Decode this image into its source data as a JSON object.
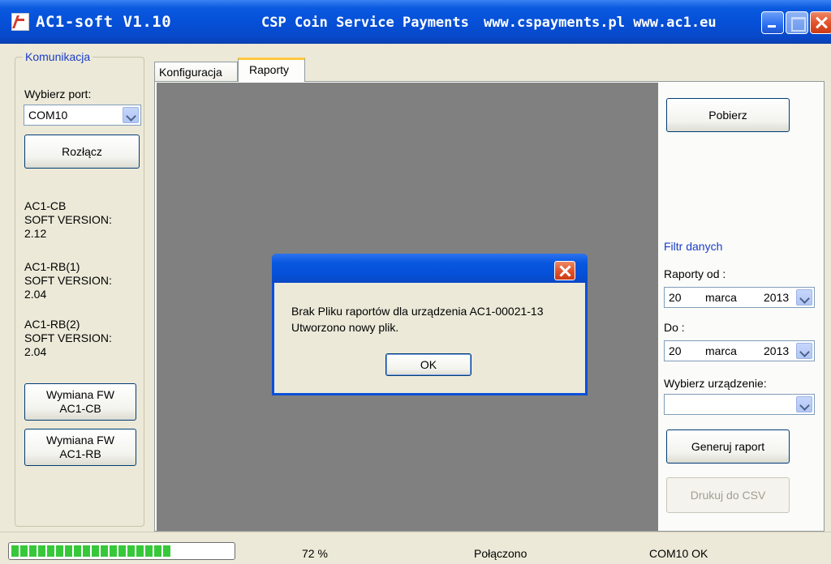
{
  "window": {
    "app_title": "AC1-soft V1.10",
    "company": "CSP Coin Service Payments",
    "websites": "www.cspayments.pl www.ac1.eu"
  },
  "sidebar": {
    "group_title": "Komunikacja",
    "port_label": "Wybierz port:",
    "port_value": "COM10",
    "disconnect_label": "Rozłącz",
    "devices": [
      {
        "line1": "AC1-CB",
        "line2": "SOFT VERSION:",
        "line3": "2.12"
      },
      {
        "line1": "AC1-RB(1)",
        "line2": "SOFT VERSION:",
        "line3": "2.04"
      },
      {
        "line1": "AC1-RB(2)",
        "line2": "SOFT VERSION:",
        "line3": "2.04"
      }
    ],
    "fw_cb_line1": "Wymiana FW",
    "fw_cb_line2": "AC1-CB",
    "fw_rb_line1": "Wymiana FW",
    "fw_rb_line2": "AC1-RB"
  },
  "tabs": [
    {
      "label": "Konfiguracja",
      "active": false
    },
    {
      "label": "Raporty",
      "active": true
    }
  ],
  "reports": {
    "fetch_label": "Pobierz",
    "filter_title": "Filtr danych",
    "from_label": "Raporty od :",
    "from_day": "20",
    "from_month": "marca",
    "from_year": "2013",
    "to_label": "Do :",
    "to_day": "20",
    "to_month": "marca",
    "to_year": "2013",
    "device_label": "Wybierz urządzenie:",
    "device_value": "",
    "generate_label": "Generuj raport",
    "csv_label": "Drukuj do CSV"
  },
  "dialog": {
    "line1": "Brak Pliku raportów dla urządzenia AC1-00021-13",
    "line2": "Utworzono nowy plik.",
    "ok_label": "OK"
  },
  "statusbar": {
    "progress_percent": 72,
    "percent_text": "72 %",
    "connection_status": "Połączono",
    "port_status": "COM10 OK"
  },
  "colors": {
    "titlebar": "#0550d8",
    "group_title": "#1a3cc8",
    "filter_title": "#1a3cc8",
    "progress_green": "#37c83a",
    "gray_area": "#808080"
  }
}
